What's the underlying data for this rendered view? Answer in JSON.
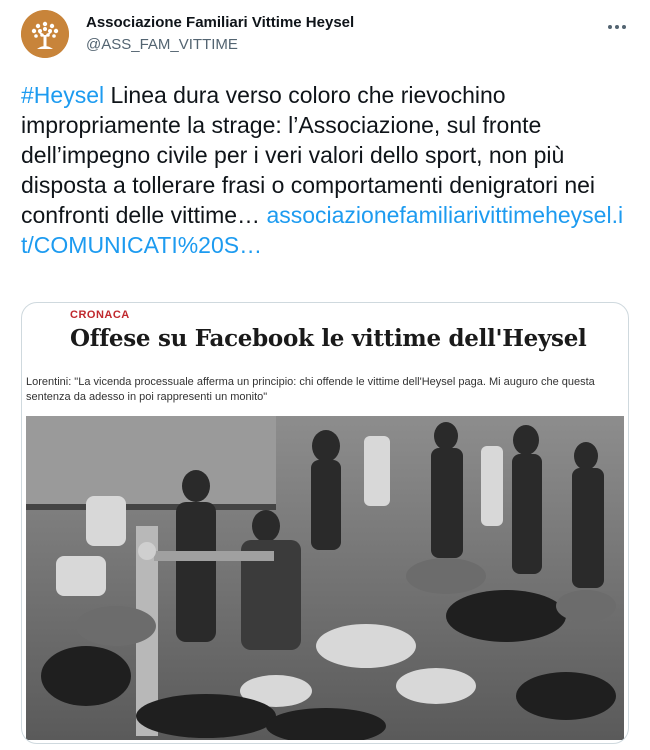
{
  "author": {
    "name": "Associazione Familiari Vittime Heysel",
    "handle": "@ASS_FAM_VITTIME",
    "avatar_icon": "tree-logo-icon"
  },
  "tweet": {
    "hashtag": "#Heysel",
    "text": "Linea dura verso coloro che rievochino impropriamente la strage: l’Associazione, sul fronte dell’impegno civile per i veri valori dello sport, non più disposta a tollerare frasi o comportamenti denigratori nei confronti delle vittime…",
    "link": "associazionefamiliarivittimeheysel.it/COMUNICATI%20S…"
  },
  "card": {
    "section": "CRONACA",
    "headline": "Offese su Facebook le vittime dell'Heysel",
    "subheadline": "Lorentini: \"La vicenda processuale afferma un principio: chi offende le vittime dell'Heysel paga. Mi auguro che questa sentenza da adesso in poi rappresenti un monito\"",
    "image_icon": "news-photo-image"
  },
  "more_icon": "more-options-icon",
  "colors": {
    "link": "#1d9bf0",
    "handle": "#536471",
    "section": "#c0282d",
    "avatar_bg": "#c8843a"
  }
}
